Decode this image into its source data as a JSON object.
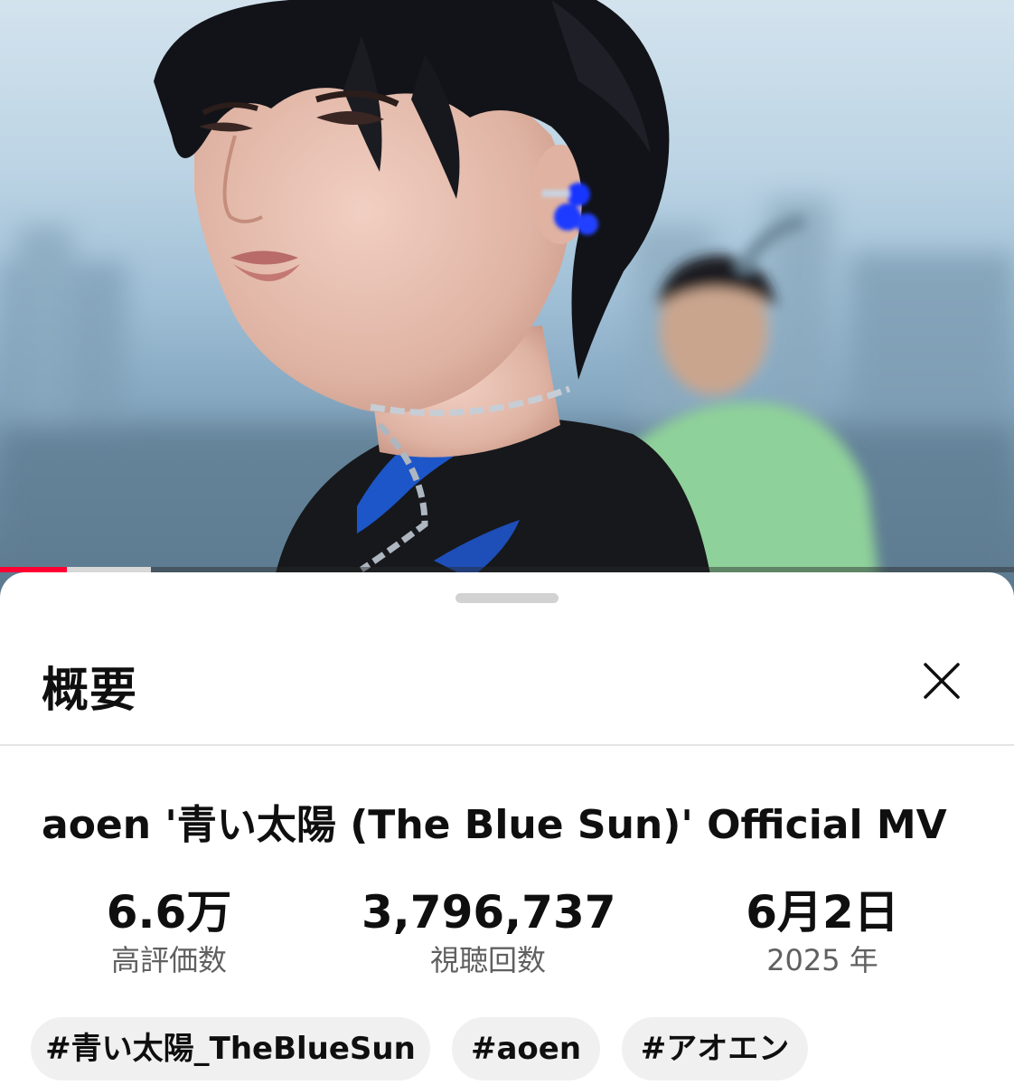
{
  "video": {
    "progress_played": 0.066,
    "progress_buffered": 0.149
  },
  "description_sheet": {
    "title": "概要",
    "video_title": "aoen '青い太陽 (The Blue Sun)' Official MV",
    "stats": [
      {
        "value": "6.6万",
        "label": "高評価数"
      },
      {
        "value": "3,796,737",
        "label": "視聴回数"
      },
      {
        "value": "6月2日",
        "label": "2025 年"
      }
    ],
    "hashtags": [
      "#青い太陽_TheBlueSun",
      "#aoen",
      "#アオエン"
    ]
  },
  "colors": {
    "progress_red": "#ff0033",
    "text_primary": "#0f0f0f",
    "text_secondary": "#606060",
    "chip_bg": "#f0f0f0"
  },
  "icons": {
    "close": "close-icon"
  }
}
